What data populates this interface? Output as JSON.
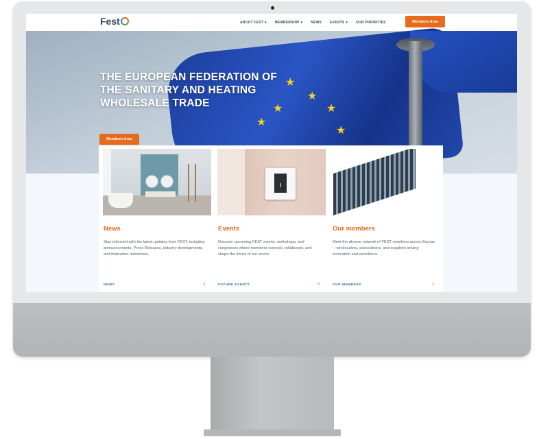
{
  "site": {
    "logo_text": "Fest",
    "nav": [
      {
        "label": "ABOUT FEST",
        "dropdown": true
      },
      {
        "label": "MEMBERSHIP",
        "dropdown": true
      },
      {
        "label": "NEWS",
        "dropdown": false
      },
      {
        "label": "EVENTS",
        "dropdown": true
      },
      {
        "label": "OUR PRIORITIES",
        "dropdown": false
      }
    ],
    "members_button": "Members Area"
  },
  "hero": {
    "title_line1": "THE EUROPEAN FEDERATION OF",
    "title_line2": "THE SANITARY AND HEATING",
    "title_line3": "WHOLESALE TRADE",
    "button": "Members Area"
  },
  "cards": [
    {
      "title": "News",
      "text": "Stay informed with the latest updates from FEST, including announcements, Press Releases, industry developments, and federation milestones.",
      "link": "NEWS"
    },
    {
      "title": "Events",
      "text": "Discover upcoming FEST events, workshops, and congresses where members connect, collaborate, and shape the future of our sector.",
      "link": "FUTURE EVENTS"
    },
    {
      "title": "Our members",
      "text": "Meet the diverse network of FEST members across Europe—wholesalers, associations, and suppliers driving innovation and excellence.",
      "link": "OUR MEMBERS"
    }
  ],
  "colors": {
    "accent": "#e86a1c",
    "text_dark": "#3b4656",
    "link_blue": "#2d6d9a",
    "flag_blue": "#1c3f9e",
    "star_yellow": "#f7d21e"
  },
  "icons": {
    "dropdown": "chevron-down-icon",
    "card_arrow": "chevron-right-icon",
    "flag_star": "star-icon"
  }
}
